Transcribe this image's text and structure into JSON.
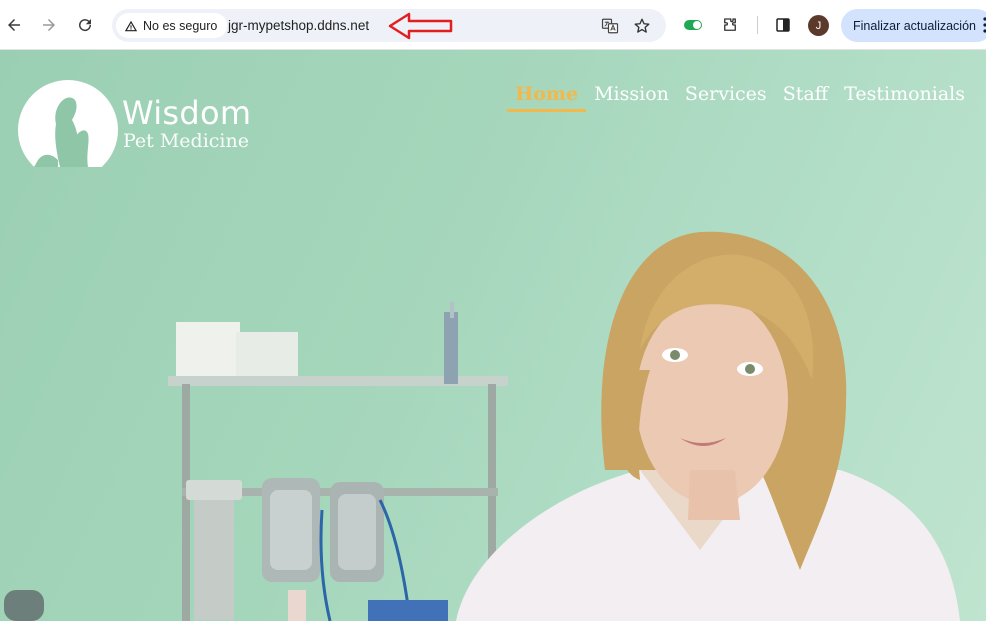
{
  "browser": {
    "security_label": "No es seguro",
    "url": "jgr-mypetshop.ddns.net",
    "avatar_initial": "J",
    "update_button_label": "Finalizar actualización",
    "icons": [
      "back-icon",
      "forward-icon",
      "reload-icon",
      "warning-icon",
      "translate-icon",
      "star-icon",
      "extension-toggle-icon",
      "puzzle-icon",
      "side-panel-icon",
      "kebab-menu-icon"
    ],
    "annotation_color": "#e02020"
  },
  "site": {
    "brand_name": "Wisdom",
    "brand_subtitle": "Pet Medicine",
    "nav": [
      {
        "label": "Home",
        "active": true
      },
      {
        "label": "Mission",
        "active": false
      },
      {
        "label": "Services",
        "active": false
      },
      {
        "label": "Staff",
        "active": false
      },
      {
        "label": "Testimonials",
        "active": false
      }
    ],
    "accent_color": "#f2b84b",
    "hero_background": "#a4d6bb"
  }
}
